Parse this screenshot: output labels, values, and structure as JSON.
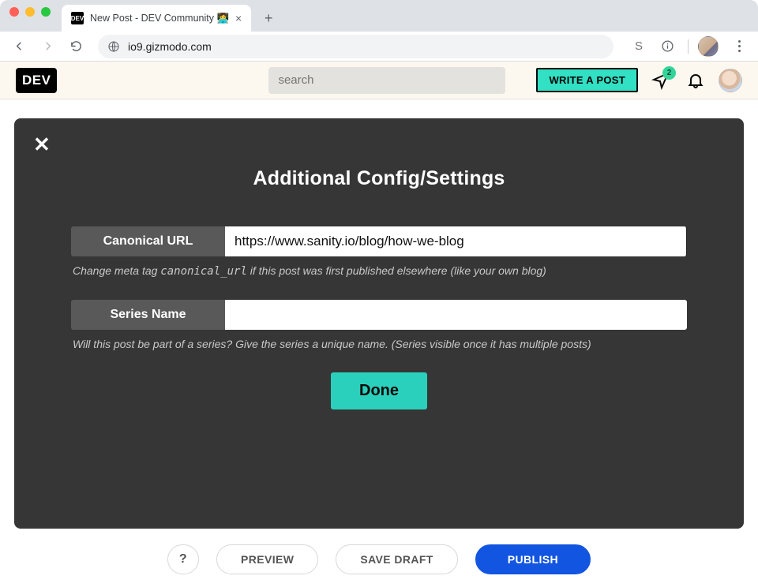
{
  "browser": {
    "tab_title": "New Post - DEV Community 👩‍💻",
    "favicon_text": "DEV",
    "url": "io9.gizmodo.com",
    "s_indicator": "S"
  },
  "site_header": {
    "logo_text": "DEV",
    "search_placeholder": "search",
    "write_post_label": "WRITE A POST",
    "notif_count": "2"
  },
  "modal": {
    "title": "Additional Config/Settings",
    "fields": {
      "canonical": {
        "label": "Canonical URL",
        "value": "https://www.sanity.io/blog/how-we-blog",
        "help_pre": "Change meta tag ",
        "help_code": "canonical_url",
        "help_post": " if this post was first published elsewhere (like your own blog)"
      },
      "series": {
        "label": "Series Name",
        "value": "",
        "help": "Will this post be part of a series? Give the series a unique name. (Series visible once it has multiple posts)"
      }
    },
    "done_label": "Done"
  },
  "action_bar": {
    "help": "?",
    "preview": "PREVIEW",
    "save_draft": "SAVE DRAFT",
    "publish": "PUBLISH"
  }
}
